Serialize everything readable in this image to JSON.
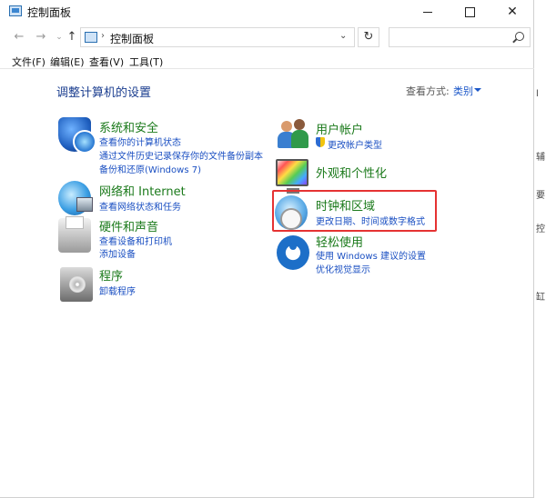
{
  "window": {
    "title": "控制面板"
  },
  "address": {
    "path": "控制面板",
    "search_placeholder": ""
  },
  "menu": [
    "文件(F)",
    "编辑(E)",
    "查看(V)",
    "工具(T)"
  ],
  "content": {
    "heading": "调整计算机的设置",
    "view_by_label": "查看方式:",
    "view_by_value": "类别"
  },
  "categories": {
    "system_security": {
      "title": "系统和安全",
      "links": [
        "查看你的计算机状态",
        "通过文件历史记录保存你的文件备份副本",
        "备份和还原(Windows 7)"
      ]
    },
    "network": {
      "title": "网络和 Internet",
      "links": [
        "查看网络状态和任务"
      ]
    },
    "hardware": {
      "title": "硬件和声音",
      "links": [
        "查看设备和打印机",
        "添加设备"
      ]
    },
    "programs": {
      "title": "程序",
      "links": [
        "卸载程序"
      ]
    },
    "user_accounts": {
      "title": "用户帐户",
      "links": [
        "更改帐户类型"
      ]
    },
    "appearance": {
      "title": "外观和个性化",
      "links": []
    },
    "clock_region": {
      "title": "时钟和区域",
      "links": [
        "更改日期、时间或数字格式"
      ]
    },
    "ease_access": {
      "title": "轻松使用",
      "links": [
        "使用 Windows 建议的设置",
        "优化视觉显示"
      ]
    }
  },
  "right_strip_chars": [
    "l",
    "辅",
    "要",
    "控",
    "缸"
  ],
  "colors": {
    "category_title": "#1b7a1b",
    "link": "#1a4fc2",
    "heading": "#1a3d8f",
    "highlight": "#e53232"
  }
}
